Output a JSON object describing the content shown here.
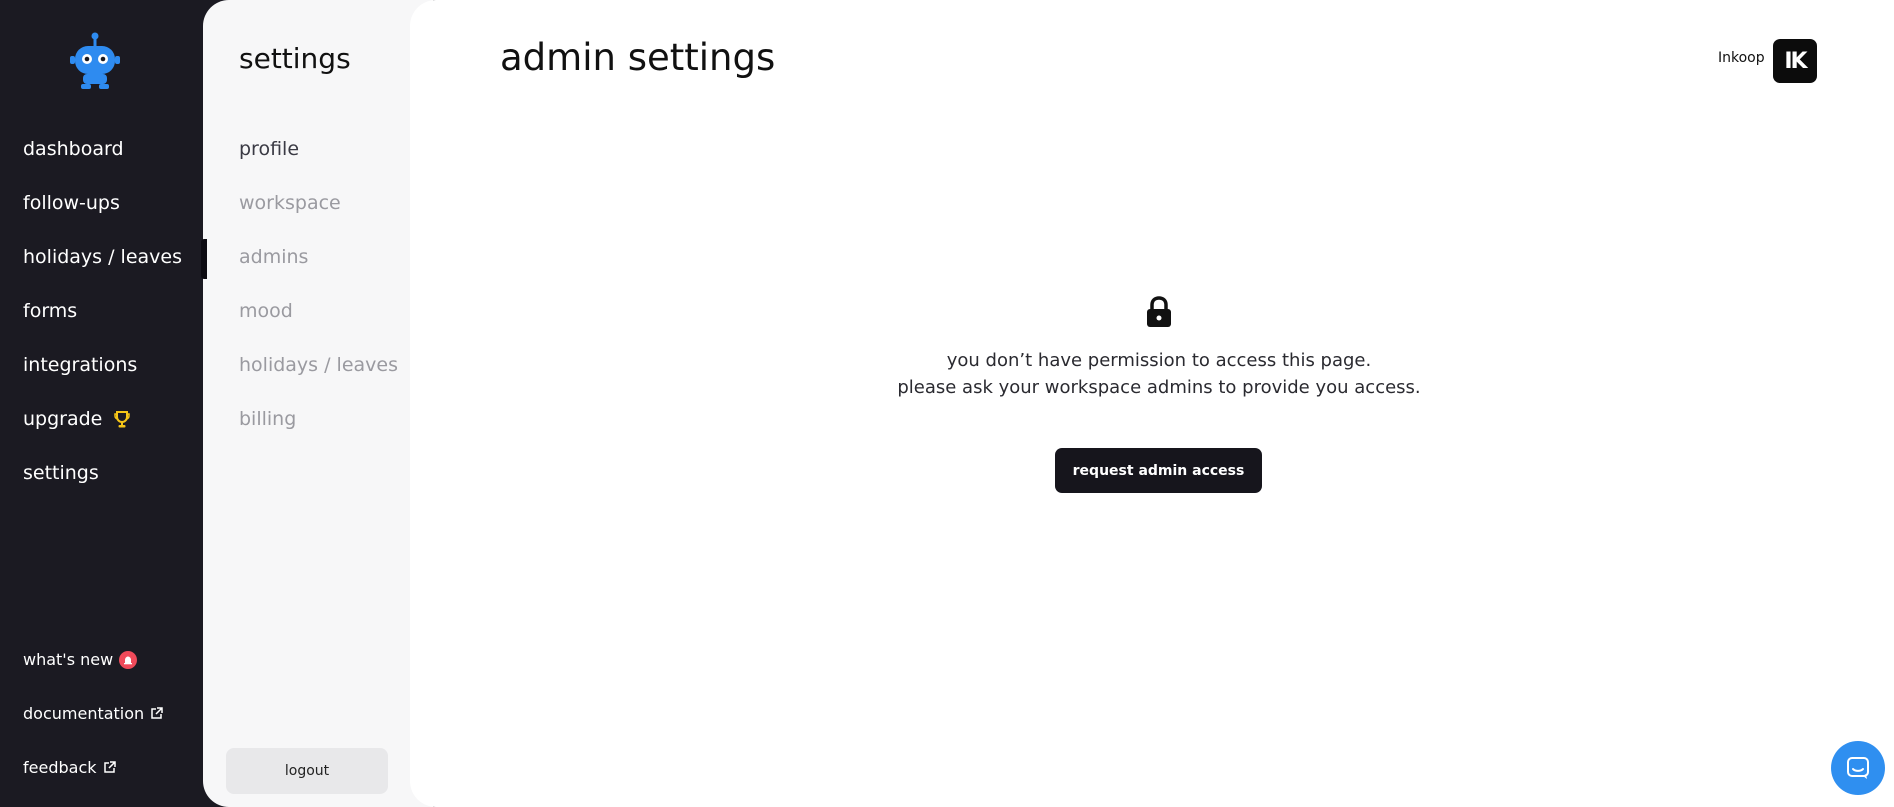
{
  "nav": {
    "items": [
      {
        "label": "dashboard"
      },
      {
        "label": "follow-ups"
      },
      {
        "label": "holidays / leaves"
      },
      {
        "label": "forms"
      },
      {
        "label": "integrations"
      },
      {
        "label": "upgrade"
      },
      {
        "label": "settings"
      }
    ],
    "bottom": {
      "whats_new": "what's new",
      "documentation": "documentation",
      "feedback": "feedback"
    }
  },
  "settings_panel": {
    "title": "settings",
    "items": [
      {
        "label": "profile"
      },
      {
        "label": "workspace"
      },
      {
        "label": "admins"
      },
      {
        "label": "mood"
      },
      {
        "label": "holidays / leaves"
      },
      {
        "label": "billing"
      }
    ],
    "logout": "logout"
  },
  "main": {
    "title": "admin settings",
    "user": {
      "name": "Inkoop",
      "avatar_text": "IK"
    },
    "message_line1": "you don’t have permission to access this page.",
    "message_line2": "please ask your workspace admins to provide you access.",
    "request_button": "request admin access"
  },
  "colors": {
    "nav_bg": "#1b1a22",
    "accent_blue": "#2f8ff0",
    "button_dark": "#16151c"
  },
  "icons": {
    "logo": "robot-logo-icon",
    "trophy": "trophy-icon",
    "alert": "alert-badge-icon",
    "external": "external-link-icon",
    "lock": "lock-icon",
    "chat": "chat-bubble-icon"
  }
}
